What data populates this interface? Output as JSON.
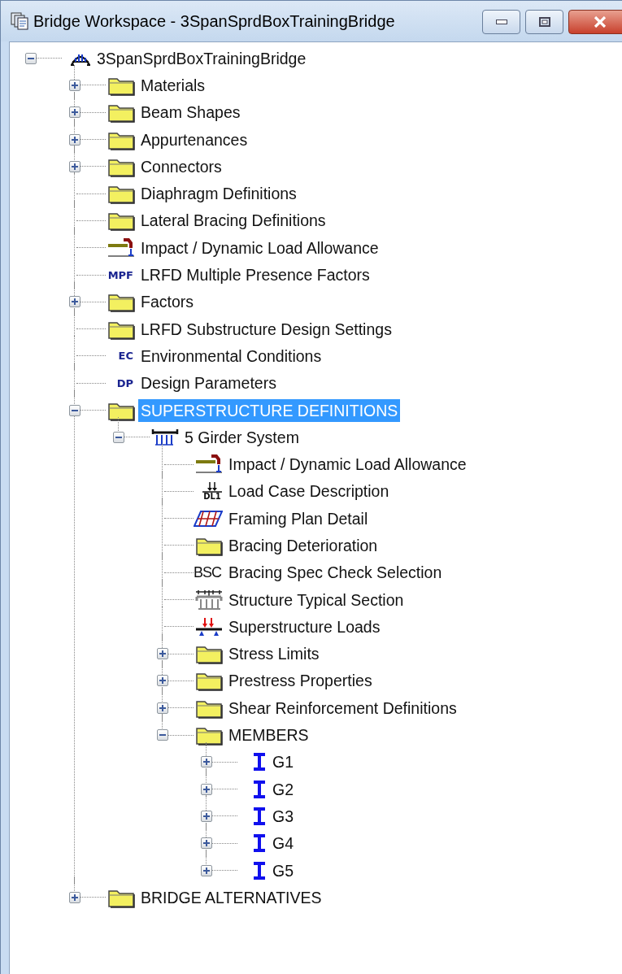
{
  "window": {
    "title": "Bridge Workspace - 3SpanSprdBoxTrainingBridge"
  },
  "tree": [
    {
      "label": "3SpanSprdBoxTrainingBridge",
      "kind": "bridge",
      "expanded": true,
      "selected": false,
      "children": [
        {
          "label": "Materials",
          "kind": "folder",
          "expanded": false,
          "selected": false
        },
        {
          "label": "Beam Shapes",
          "kind": "folder",
          "expanded": false,
          "selected": false
        },
        {
          "label": "Appurtenances",
          "kind": "folder",
          "expanded": false,
          "selected": false
        },
        {
          "label": "Connectors",
          "kind": "folder",
          "expanded": false,
          "selected": false
        },
        {
          "label": "Diaphragm Definitions",
          "kind": "folder",
          "selected": false
        },
        {
          "label": "Lateral Bracing Definitions",
          "kind": "folder",
          "selected": false
        },
        {
          "label": "Impact / Dynamic Load Allowance",
          "kind": "impact",
          "selected": false
        },
        {
          "label": "LRFD Multiple Presence Factors",
          "kind": "code",
          "icon_text": "MPF",
          "selected": false
        },
        {
          "label": "Factors",
          "kind": "folder",
          "expanded": false,
          "selected": false
        },
        {
          "label": "LRFD Substructure Design Settings",
          "kind": "folder",
          "selected": false
        },
        {
          "label": "Environmental Conditions",
          "kind": "code",
          "icon_text": "EC",
          "selected": false
        },
        {
          "label": "Design Parameters",
          "kind": "code",
          "icon_text": "DP",
          "selected": false
        },
        {
          "label": "SUPERSTRUCTURE DEFINITIONS",
          "kind": "folder",
          "expanded": true,
          "selected": true,
          "children": [
            {
              "label": "5 Girder System",
              "kind": "girders",
              "expanded": true,
              "selected": false,
              "children": [
                {
                  "label": "Impact / Dynamic Load Allowance",
                  "kind": "impact",
                  "selected": false
                },
                {
                  "label": "Load Case Description",
                  "kind": "loadcase",
                  "icon_text": "DL1",
                  "selected": false
                },
                {
                  "label": "Framing Plan Detail",
                  "kind": "framing",
                  "selected": false
                },
                {
                  "label": "Bracing Deterioration",
                  "kind": "folder",
                  "selected": false
                },
                {
                  "label": "Bracing Spec Check Selection",
                  "kind": "plaincode",
                  "icon_text": "BSC",
                  "selected": false
                },
                {
                  "label": "Structure Typical Section",
                  "kind": "section",
                  "selected": false
                },
                {
                  "label": "Superstructure Loads",
                  "kind": "loads",
                  "selected": false
                },
                {
                  "label": "Stress Limits",
                  "kind": "folder",
                  "expanded": false,
                  "selected": false
                },
                {
                  "label": "Prestress Properties",
                  "kind": "folder",
                  "expanded": false,
                  "selected": false
                },
                {
                  "label": "Shear Reinforcement Definitions",
                  "kind": "folder",
                  "expanded": false,
                  "selected": false
                },
                {
                  "label": "MEMBERS",
                  "kind": "folder",
                  "expanded": true,
                  "selected": false,
                  "children": [
                    {
                      "label": "G1",
                      "kind": "member",
                      "expanded": false,
                      "selected": false
                    },
                    {
                      "label": "G2",
                      "kind": "member",
                      "expanded": false,
                      "selected": false
                    },
                    {
                      "label": "G3",
                      "kind": "member",
                      "expanded": false,
                      "selected": false
                    },
                    {
                      "label": "G4",
                      "kind": "member",
                      "expanded": false,
                      "selected": false
                    },
                    {
                      "label": "G5",
                      "kind": "member",
                      "expanded": false,
                      "selected": false
                    }
                  ]
                }
              ]
            }
          ]
        },
        {
          "label": "BRIDGE ALTERNATIVES",
          "kind": "folder",
          "expanded": false,
          "selected": false
        }
      ]
    }
  ]
}
